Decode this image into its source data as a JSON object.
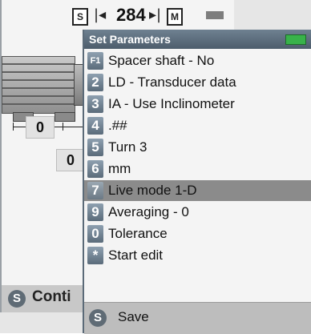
{
  "background": {
    "top_tag_left": "S",
    "top_tag_right": "M",
    "top_value": "284",
    "arrow_left": "|◂",
    "arrow_right": "▸|",
    "value_left": "0",
    "value_right": "0",
    "status_key": "S",
    "status_label": "Conti"
  },
  "popup": {
    "title": "Set Parameters",
    "battery_color": "#38b24a",
    "items": [
      {
        "key": "F1",
        "label": "Spacer shaft - No"
      },
      {
        "key": "2",
        "label": "LD - Transducer data"
      },
      {
        "key": "3",
        "label": "IA - Use Inclinometer"
      },
      {
        "key": "4",
        "label": ".##"
      },
      {
        "key": "5",
        "label": "Turn  3"
      },
      {
        "key": "6",
        "label": "mm"
      },
      {
        "key": "7",
        "label": "Live mode 1-D"
      },
      {
        "key": "9",
        "label": "Averaging - 0"
      },
      {
        "key": "0",
        "label": "Tolerance"
      },
      {
        "key": "*",
        "label": "Start edit"
      }
    ],
    "selected_index": 6,
    "footer_key": "S",
    "footer_label": "Save"
  }
}
